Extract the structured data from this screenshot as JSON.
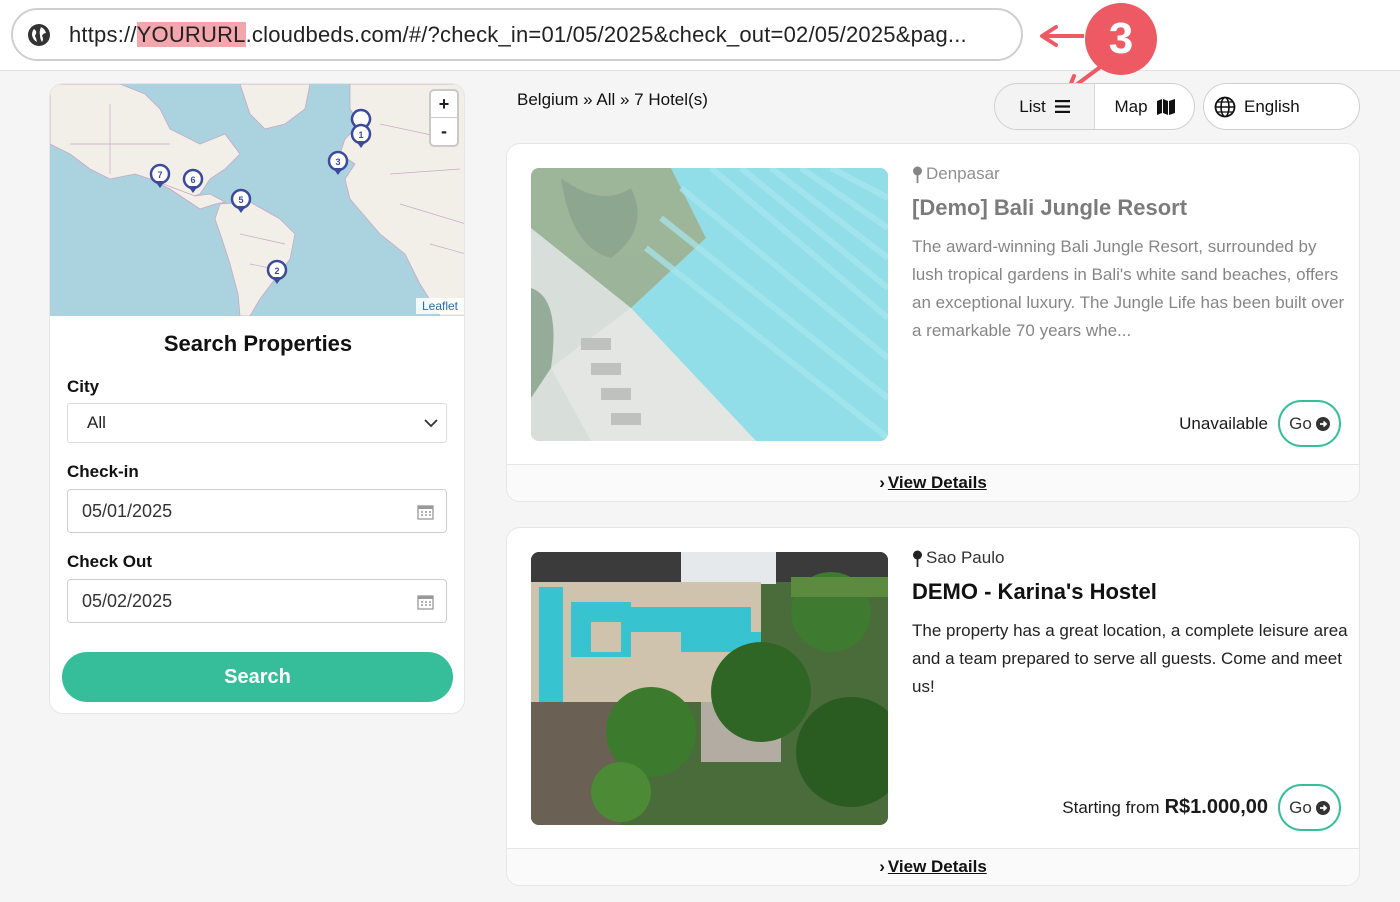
{
  "browser": {
    "url_prefix": "https://",
    "url_highlight": "YOURURL",
    "url_suffix": ".cloudbeds.com/#/?check_in=01/05/2025&check_out=02/05/2025&pag...",
    "annotation_number": "3",
    "annotation_color": "#ee5a63"
  },
  "map": {
    "attribution": "Leaflet",
    "zoom_in": "+",
    "zoom_out": "-",
    "markers": [
      "1",
      "2",
      "3",
      "5",
      "6",
      "7"
    ],
    "marker_color": "#3c4a9c"
  },
  "search": {
    "title": "Search Properties",
    "city_label": "City",
    "city_value": "All",
    "checkin_label": "Check-in",
    "checkin_value": "05/01/2025",
    "checkout_label": "Check Out",
    "checkout_value": "05/02/2025",
    "button_label": "Search",
    "accent_color": "#36be9b"
  },
  "results": {
    "breadcrumb": "Belgium » All » 7 Hotel(s)",
    "view_list": "List",
    "view_map": "Map",
    "language": "English"
  },
  "hotels": [
    {
      "location": "Denpasar",
      "name": "[Demo] Bali Jungle Resort",
      "description": "The award-winning Bali Jungle Resort, surrounded by lush tropical gardens in Bali's white sand beaches, offers an exceptional luxury. The Jungle Life has been built over a remarkable 70 years whe...",
      "status": "Unavailable",
      "go_label": "Go",
      "details_label": "View Details"
    },
    {
      "location": "Sao Paulo",
      "name": "DEMO - Karina's Hostel",
      "description": "The  property has a great location, a complete leisure area and a team prepared to serve all guests. Come and meet us!",
      "price_prefix": "Starting from",
      "price": "R$1.000,00",
      "go_label": "Go",
      "details_label": "View Details"
    }
  ]
}
